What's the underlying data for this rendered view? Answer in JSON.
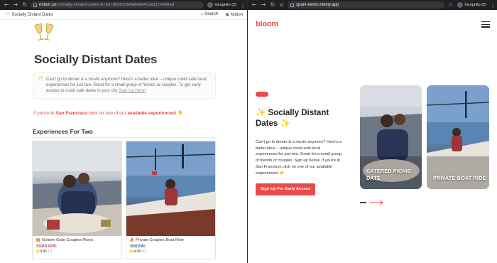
{
  "left_window": {
    "browser": {
      "url_host": "notion.so",
      "url_path": "/Socially-Distant-Dates-b78379d6910a4a8e8e4c3a31f1448fad",
      "incognito": "Incognito (2)"
    },
    "topbar": {
      "breadcrumb": "Socially Distant Dates",
      "search": "Search",
      "notion": "Notion"
    },
    "page": {
      "title": "Socially Distant Dates",
      "callout_text": "Can't go to dinner & a movie anymore? Here's a better idea -- unique covid safe local experiences for just two. Great for a small group of friends or couples. To get early access to covid safe dates in your city",
      "callout_link": "Sign Up Here!",
      "sf_prefix": "If you're in",
      "sf_city": "San Francisco",
      "sf_middle": "click on one of our",
      "sf_emph": "available experiences!",
      "section_title": "Experiences For Two",
      "cards": [
        {
          "title": "Golden Gate Couples Picnic",
          "tag": "Food & Drink",
          "rating": "4.95",
          "count": "(7)"
        },
        {
          "title": "Private Couples Boat Ride",
          "tag": "Boat Ride",
          "rating": "4.94",
          "count": "(7)"
        }
      ]
    }
  },
  "right_window": {
    "browser": {
      "url_host": "spark-demo.netlify.app",
      "incognito": "Incognito (2)"
    },
    "logo": "bloom",
    "hero_title": "Socially Distant Dates",
    "hero_emoji": "✨",
    "hero_desc": "Can't go to dinner & a movie anymore? Here's a better idea -- unique covid safe local experiences for just two. Great for a small group of friends or couples. Sign up below. If you're in San Francisco click on one of our available experiences! 👉",
    "cta": "Sign Up For Early Access",
    "photo_cards": [
      {
        "label": "CATERED PICNIC DATE"
      },
      {
        "label": "PRIVATE BOAT RIDE"
      }
    ]
  },
  "colors": {
    "brand_red": "#e74c4c",
    "notion_red": "#e03e3e",
    "chrome_dark": "#202124"
  }
}
